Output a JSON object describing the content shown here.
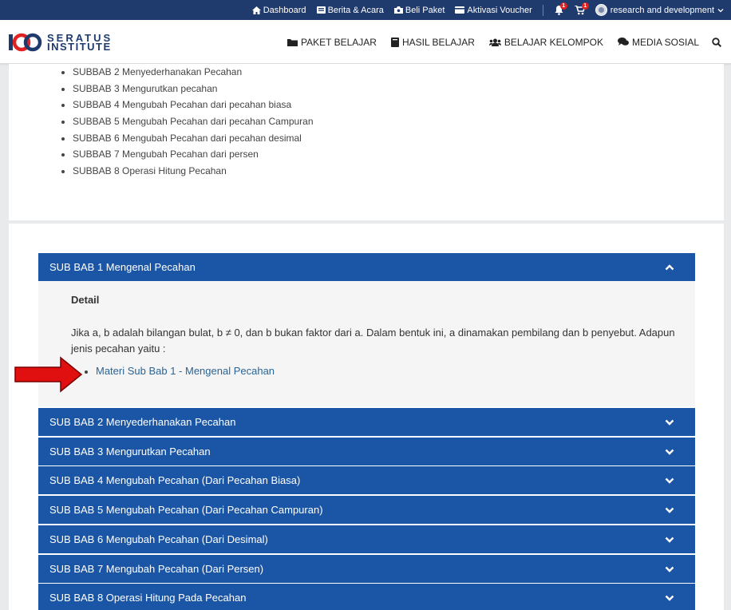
{
  "topbar": {
    "items": [
      {
        "label": "Dashboard",
        "icon": "home-icon"
      },
      {
        "label": "Berita & Acara",
        "icon": "news-icon"
      },
      {
        "label": "Beli Paket",
        "icon": "camera-icon"
      },
      {
        "label": "Aktivasi Voucher",
        "icon": "card-icon"
      }
    ],
    "notif_badge": "1",
    "cart_badge": "1",
    "user_label": "research and development"
  },
  "brand": {
    "line1": "SERATUS",
    "line2": "INSTITUTE"
  },
  "nav": [
    {
      "label": "PAKET BELAJAR",
      "icon": "folder-icon"
    },
    {
      "label": "HASIL BELAJAR",
      "icon": "book-icon"
    },
    {
      "label": "BELAJAR KELOMPOK",
      "icon": "users-icon"
    },
    {
      "label": "MEDIA SOSIAL",
      "icon": "comments-icon"
    }
  ],
  "subbab_list": [
    "SUBBAB 2  Menyederhanakan Pecahan",
    "SUBBAB 3 Mengurutkan pecahan",
    "SUBBAB 4 Mengubah Pecahan dari pecahan biasa",
    "SUBBAB 5 Mengubah Pecahan dari pecahan Campuran",
    "SUBBAB 6  Mengubah Pecahan dari pecahan desimal",
    "SUBBAB 7 Mengubah Pecahan dari persen",
    "SUBBAB 8 Operasi Hitung Pecahan"
  ],
  "accordion": {
    "open_section": {
      "title": "SUB BAB 1 Mengenal Pecahan",
      "detail_title": "Detail",
      "detail_text": "Jika a, b adalah bilangan bulat, b ≠  0, dan b bukan faktor dari a. Dalam bentuk ini, a dinamakan pembilang dan b penyebut. Adapun jenis pecahan yaitu :",
      "link": "Materi Sub Bab 1 - Mengenal Pecahan"
    },
    "sections": [
      "SUB BAB 2 Menyederhanakan Pecahan",
      "SUB BAB 3 Mengurutkan Pecahan",
      "SUB BAB 4 Mengubah Pecahan (Dari Pecahan Biasa)",
      "SUB BAB 5 Mengubah Pecahan (Dari Pecahan Campuran)",
      "SUB BAB 6 Mengubah Pecahan (Dari Desimal)",
      "SUB BAB 7 Mengubah Pecahan (Dari Persen)",
      "SUB BAB 8 Operasi Hitung Pada Pecahan"
    ]
  },
  "colors": {
    "topbar": "#1f3a6d",
    "accordion": "#1b56a6",
    "arrow": "#e01010",
    "link": "#2a6496"
  }
}
